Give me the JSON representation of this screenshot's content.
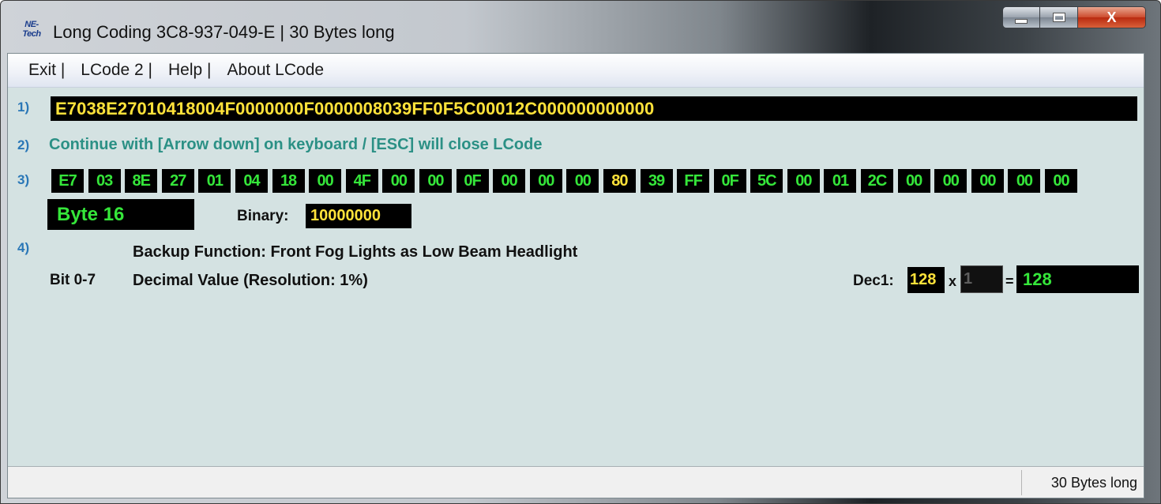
{
  "window": {
    "app_logo_line1": "NE-",
    "app_logo_line2": "Tech",
    "title": "Long Coding  3C8-937-049-E | 30 Bytes long",
    "minimize_icon": "minimize-icon",
    "maximize_icon": "maximize-icon",
    "close_glyph": "X"
  },
  "menu": {
    "items": [
      "Exit |",
      "LCode 2 |",
      "Help |",
      "About LCode"
    ]
  },
  "section1": {
    "label": "1)",
    "coding_string": "E7038E27010418004F0000000F0000008039FF0F5C00012C000000000000"
  },
  "section2": {
    "label": "2)",
    "hint": "Continue with [Arrow down] on keyboard / [ESC] will close LCode"
  },
  "section3": {
    "label": "3)",
    "bytes": [
      "E7",
      "03",
      "8E",
      "27",
      "01",
      "04",
      "18",
      "00",
      "4F",
      "00",
      "00",
      "0F",
      "00",
      "00",
      "00",
      "80",
      "39",
      "FF",
      "0F",
      "5C",
      "00",
      "01",
      "2C",
      "00",
      "00",
      "00",
      "00",
      "00"
    ],
    "selected_byte_number": 16,
    "byte_label": "Byte 16",
    "binary_label": "Binary:",
    "binary_value": "10000000"
  },
  "section4": {
    "label": "4)",
    "bit_range": "Bit 0-7",
    "function_title": "Backup Function: Front Fog Lights as Low Beam Headlight",
    "value_description": "Decimal Value (Resolution: 1%)",
    "dec_label": "Dec1:",
    "dec_value": "128",
    "times_symbol": "x",
    "multiplier": "1",
    "equals_symbol": "=",
    "result": "128"
  },
  "status": {
    "text": "30 Bytes long"
  },
  "colors": {
    "byte_text": "#35e63a",
    "selected_byte_text": "#ffe23a",
    "label_blue": "#2a77b7",
    "hint_teal": "#2b9085",
    "client_bg": "#d4e2e2"
  }
}
